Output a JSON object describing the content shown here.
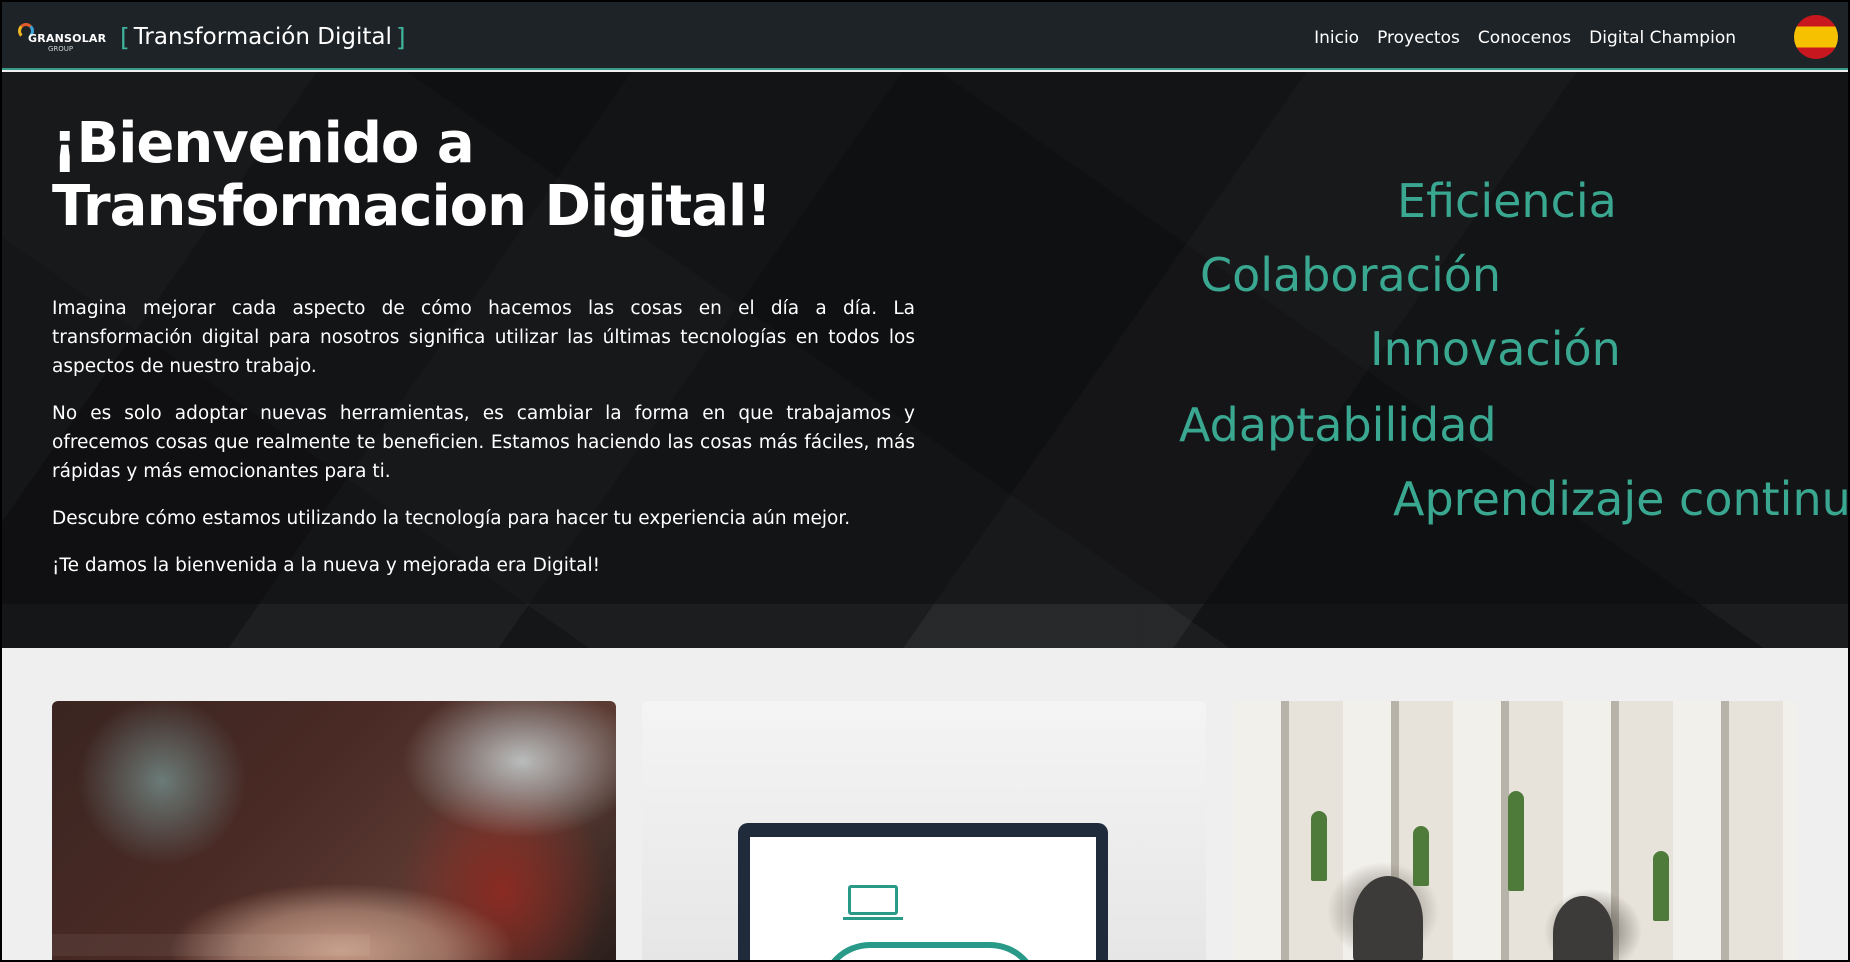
{
  "navbar": {
    "logo_text": "GRANSOLAR",
    "logo_sub": "GROUP",
    "brand_open": "[",
    "brand_title": "Transformación Digital",
    "brand_close": "]",
    "links": [
      "Inicio",
      "Proyectos",
      "Conocenos",
      "Digital Champion"
    ],
    "language": "español"
  },
  "hero": {
    "title": "¡Bienvenido a Transformacion Digital!",
    "paragraphs": [
      "Imagina mejorar cada aspecto de cómo hacemos las cosas en el día a día. La transformación digital para nosotros significa utilizar las últimas tecnologías en todos los aspectos de nuestro trabajo.",
      "No es solo adoptar nuevas herramientas, es cambiar la forma en que trabajamos y ofrecemos cosas que realmente te beneficien. Estamos haciendo las cosas más fáciles, más rápidas y más emocionantes para ti.",
      "Descubre cómo estamos utilizando la tecnología para hacer tu experiencia aún mejor.",
      "¡Te damos la bienvenida a la nueva y mejorada era Digital!"
    ],
    "values": [
      "Eficiencia",
      "Colaboración",
      "Innovación",
      "Adaptabilidad",
      "Aprendizaje continuo"
    ]
  },
  "colors": {
    "accent": "#3aa891",
    "navbar_bg": "#1e2327",
    "page_bg": "#efefef"
  }
}
